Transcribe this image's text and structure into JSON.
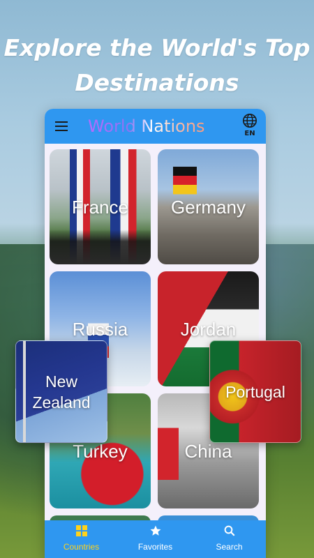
{
  "headline": {
    "line1": "Explore the World's Top",
    "line2": "Destinations"
  },
  "appbar": {
    "title": "World Nations",
    "language": "EN",
    "menu_icon": "hamburger-menu-icon",
    "language_icon": "globe-icon"
  },
  "countries": [
    {
      "name": "France"
    },
    {
      "name": "Germany"
    },
    {
      "name": "Russia"
    },
    {
      "name": "Jordan"
    },
    {
      "name": "Turkey"
    },
    {
      "name": "China"
    }
  ],
  "floating_cards": [
    {
      "name_line1": "New",
      "name_line2": "Zealand"
    },
    {
      "name_line1": "Portugal",
      "name_line2": ""
    }
  ],
  "bottom_nav": {
    "items": [
      {
        "label": "Countries",
        "icon": "grid-icon",
        "active": true
      },
      {
        "label": "Favorites",
        "icon": "star-icon",
        "active": false
      },
      {
        "label": "Search",
        "icon": "search-icon",
        "active": false
      }
    ]
  },
  "colors": {
    "primary": "#2f97f0",
    "active_nav": "#ffd21a",
    "surface": "#f4f0fb"
  }
}
